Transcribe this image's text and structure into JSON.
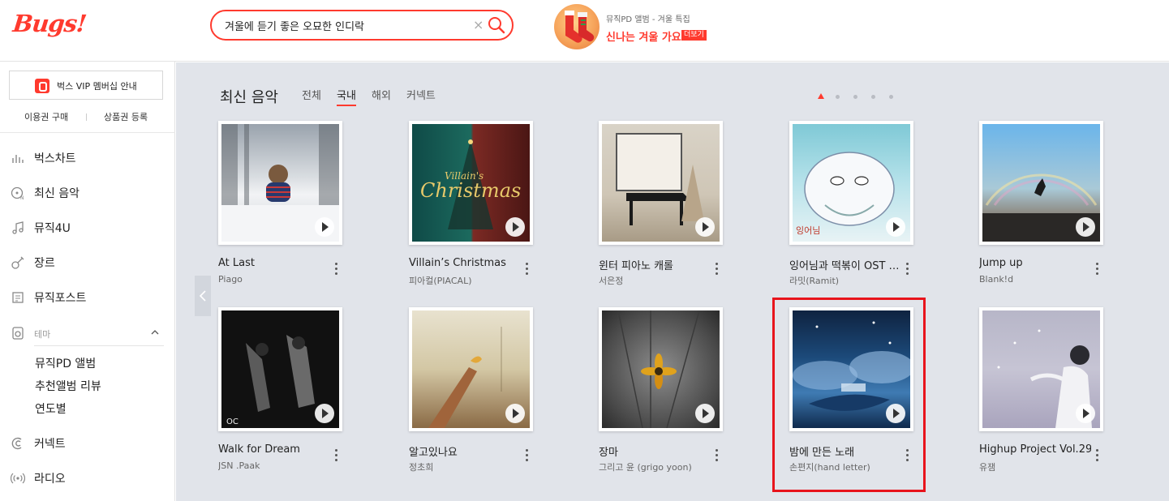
{
  "header": {
    "logo": "Bugs!",
    "search": {
      "value": "겨울에 듣기 좋은 오묘한 인디락",
      "clear_icon": "×"
    },
    "promo": {
      "subtitle": "뮤직PD 앨범 - 겨울 특집",
      "title": "신나는 겨울 가요",
      "more_label": "더보기"
    }
  },
  "sidebar": {
    "vip_label": "벅스 VIP 멤버십 안내",
    "buy_label": "이용권 구매",
    "register_label": "상품권 등록",
    "nav": [
      {
        "label": "벅스차트",
        "icon": "chart-icon"
      },
      {
        "label": "최신 음악",
        "icon": "new-music-icon"
      },
      {
        "label": "뮤직4U",
        "icon": "music-note-icon"
      },
      {
        "label": "장르",
        "icon": "guitar-icon"
      },
      {
        "label": "뮤직포스트",
        "icon": "post-icon"
      }
    ],
    "theme": {
      "label": "테마",
      "items": [
        "뮤직PD 앨범",
        "추천앨범 리뷰",
        "연도별"
      ]
    },
    "bottom_nav": [
      {
        "label": "커넥트",
        "icon": "connect-icon"
      },
      {
        "label": "라디오",
        "icon": "radio-icon"
      }
    ]
  },
  "main": {
    "section_title": "최신 음악",
    "tabs": [
      {
        "label": "전체",
        "active": false
      },
      {
        "label": "국내",
        "active": true
      },
      {
        "label": "해외",
        "active": false
      },
      {
        "label": "커넥트",
        "active": false
      }
    ],
    "pager": {
      "pages": 5,
      "current": 1
    },
    "albums": [
      {
        "title": "At Last",
        "artist": "Piago"
      },
      {
        "title": "Villain’s Christmas",
        "artist": "피아컬(PIACAL)"
      },
      {
        "title": "윈터 피아노 캐롤",
        "artist": "서은정"
      },
      {
        "title": "잉어님과 떡볶이 OST …",
        "artist": "라밋(Ramit)"
      },
      {
        "title": "Jump up",
        "artist": "Blank!d"
      },
      {
        "title": "Walk for Dream",
        "artist": "JSN .Paak"
      },
      {
        "title": "알고있나요",
        "artist": "정초희"
      },
      {
        "title": "장마",
        "artist": "그리고 윤 (grigo yoon)"
      },
      {
        "title": "밤에 만든 노래",
        "artist": "손편지(hand letter)"
      },
      {
        "title": "Highup Project Vol.29",
        "artist": "유잼"
      }
    ]
  },
  "colors": {
    "accent": "#ff3a2e",
    "main_bg": "#e1e4ea",
    "highlight": "#e8141c"
  }
}
